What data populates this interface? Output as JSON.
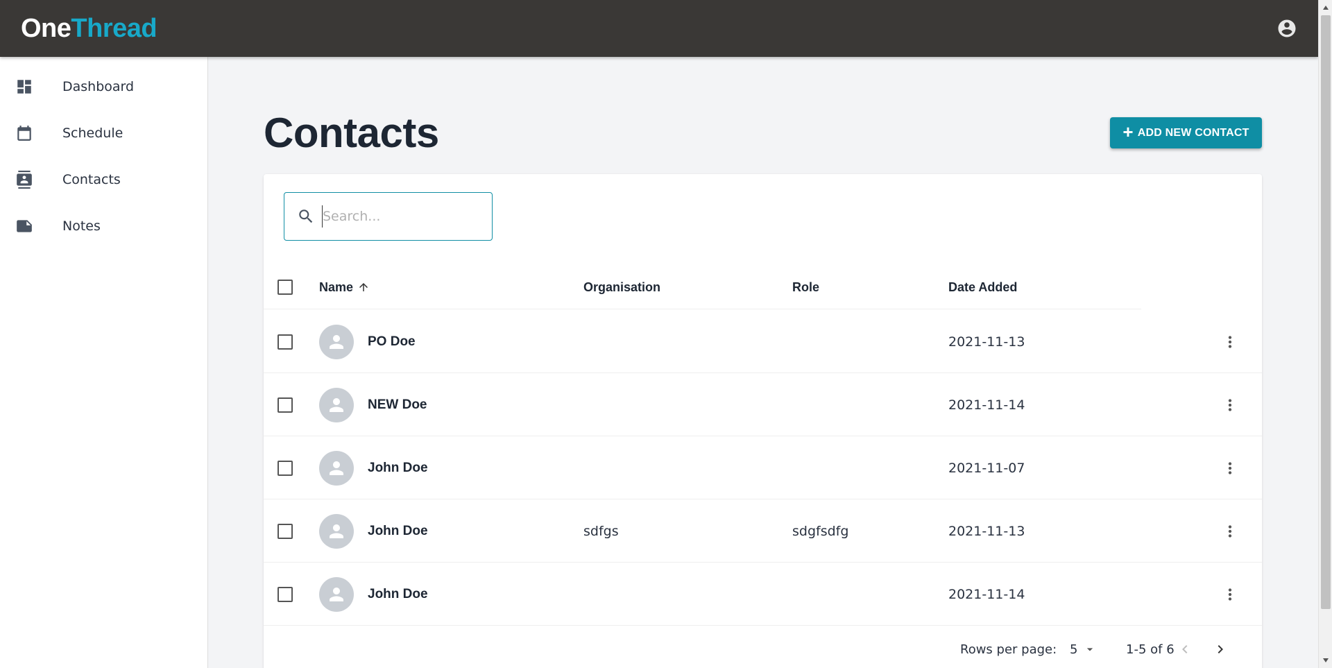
{
  "brand": {
    "part1": "One",
    "part2": "Thread"
  },
  "colors": {
    "accent": "#0f8ea4",
    "topbar": "#3a3836",
    "brand_highlight": "#18a9c9"
  },
  "header": {
    "account_icon": "account-circle-icon"
  },
  "sidebar": {
    "items": [
      {
        "label": "Dashboard",
        "icon": "dashboard-icon"
      },
      {
        "label": "Schedule",
        "icon": "calendar-icon"
      },
      {
        "label": "Contacts",
        "icon": "contacts-icon"
      },
      {
        "label": "Notes",
        "icon": "note-icon"
      }
    ]
  },
  "page": {
    "title": "Contacts",
    "add_button_label": "ADD NEW CONTACT"
  },
  "search": {
    "placeholder": "Search...",
    "value": ""
  },
  "table": {
    "columns": {
      "name": "Name",
      "organisation": "Organisation",
      "role": "Role",
      "date_added": "Date Added"
    },
    "sort": {
      "column": "Name",
      "direction": "ascending"
    },
    "rows": [
      {
        "name": "PO Doe",
        "organisation": "",
        "role": "",
        "date_added": "2021-11-13"
      },
      {
        "name": "NEW Doe",
        "organisation": "",
        "role": "",
        "date_added": "2021-11-14"
      },
      {
        "name": "John Doe",
        "organisation": "",
        "role": "",
        "date_added": "2021-11-07"
      },
      {
        "name": "John Doe",
        "organisation": "sdfgs",
        "role": "sdgfsdfg",
        "date_added": "2021-11-13"
      },
      {
        "name": "John Doe",
        "organisation": "",
        "role": "",
        "date_added": "2021-11-14"
      }
    ]
  },
  "pagination": {
    "rows_per_page_label": "Rows per page:",
    "rows_per_page_value": "5",
    "range": "1-5 of 6"
  }
}
